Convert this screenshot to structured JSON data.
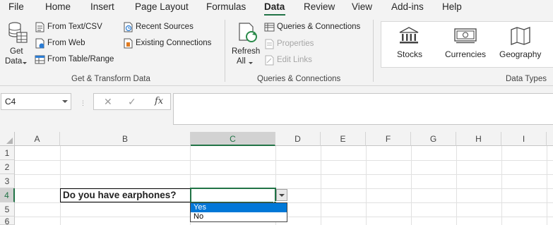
{
  "menu": {
    "tabs": [
      {
        "label": "File"
      },
      {
        "label": "Home"
      },
      {
        "label": "Insert"
      },
      {
        "label": "Page Layout"
      },
      {
        "label": "Formulas"
      },
      {
        "label": "Data",
        "active": true
      },
      {
        "label": "Review"
      },
      {
        "label": "View"
      },
      {
        "label": "Add-ins"
      },
      {
        "label": "Help"
      }
    ],
    "accent_color": "#217346"
  },
  "ribbon": {
    "get_transform": {
      "get_data_line1": "Get",
      "get_data_line2": "Data",
      "from_text_csv": "From Text/CSV",
      "from_web": "From Web",
      "from_table_range": "From Table/Range",
      "recent_sources": "Recent Sources",
      "existing_connections": "Existing Connections",
      "group_label": "Get & Transform Data"
    },
    "queries": {
      "refresh_line1": "Refresh",
      "refresh_line2": "All",
      "queries_connections": "Queries & Connections",
      "properties": "Properties",
      "edit_links": "Edit Links",
      "group_label": "Queries & Connections"
    },
    "data_types": {
      "stocks": "Stocks",
      "currencies": "Currencies",
      "geography": "Geography",
      "group_label": "Data Types"
    }
  },
  "formula_bar": {
    "name_box": "C4",
    "cancel_icon": "✕",
    "enter_icon": "✓",
    "fx_label": "fx",
    "formula": ""
  },
  "sheet": {
    "columns": [
      "A",
      "B",
      "C",
      "D",
      "E",
      "F",
      "G",
      "H",
      "I"
    ],
    "rows": [
      "1",
      "2",
      "3",
      "4",
      "5",
      "6"
    ],
    "active_cell": "C4",
    "cell_b4": "Do you have earphones?",
    "dropdown_options": [
      {
        "label": "Yes",
        "selected": true
      },
      {
        "label": "No",
        "selected": false
      }
    ]
  }
}
